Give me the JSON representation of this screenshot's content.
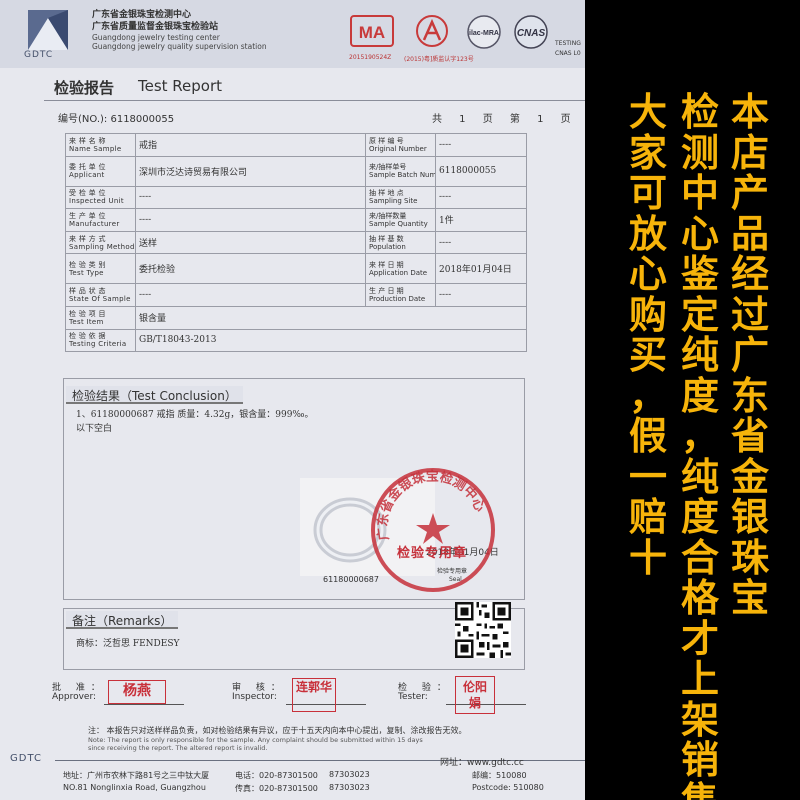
{
  "lab": {
    "name_cn_1": "广东省金银珠宝检测中心",
    "name_cn_2": "广东省质量监督金银珠宝检验站",
    "name_en_1": "Guangdong jewelry testing center",
    "name_en_2": "Guangdong jewelry quality supervision station",
    "logo_text": "GDTC"
  },
  "certs": {
    "ma": "MA",
    "ma_no": "2015190524Z",
    "ca_no": "(2015)粤]质监认字123号",
    "ilac": "ilac-MRA",
    "cnas": "CNAS",
    "testing": "TESTING",
    "cnas_no": "CNAS L0"
  },
  "report": {
    "title_cn": "检验报告",
    "title_en": "Test Report",
    "number": "编号(NO.): 6118000055",
    "page_info": "共 1 页 第 1 页"
  },
  "fields": [
    {
      "label_cn": "来 样 名 称",
      "label_en": "Name Sample",
      "value": "戒指",
      "label2_cn": "原 样 编 号",
      "label2_en": "Original Number",
      "value2": "----"
    },
    {
      "label_cn": "委 托 单 位",
      "label_en": "Applicant",
      "value": "深圳市泛达诗贸易有限公司",
      "label2_cn": "来/抽样单号",
      "label2_en": "Sample Batch Number",
      "value2": "6118000055"
    },
    {
      "label_cn": "受 检 单 位",
      "label_en": "Inspected Unit",
      "value": "----",
      "label2_cn": "抽 样 地 点",
      "label2_en": "Sampling Site",
      "value2": "----"
    },
    {
      "label_cn": "生 产 单 位",
      "label_en": "Manufacturer",
      "value": "----",
      "label2_cn": "来/抽样数量",
      "label2_en": "Sample Quantity",
      "value2": "1件"
    },
    {
      "label_cn": "来 样 方 式",
      "label_en": "Sampling Method",
      "value": "送样",
      "label2_cn": "抽 样 基 数",
      "label2_en": "Population",
      "value2": "----"
    },
    {
      "label_cn": "检 验 类 别",
      "label_en": "Test Type",
      "value": "委托检验",
      "label2_cn": "来 样 日 期",
      "label2_en": "Application Date",
      "value2": "2018年01月04日"
    },
    {
      "label_cn": "样 品 状 态",
      "label_en": "State Of Sample",
      "value": "----",
      "label2_cn": "生 产 日 期",
      "label2_en": "Production Date",
      "value2": "----"
    },
    {
      "label_cn": "检 验 项 目",
      "label_en": "Test Item",
      "value": "银含量"
    },
    {
      "label_cn": "检 验 依 据",
      "label_en": "Testing Criteria",
      "value": "GB/T18043-2013"
    }
  ],
  "conclusion": {
    "heading": "检验结果（Test Conclusion）",
    "line1": "1、61180000687    戒指   质量：4.32g，银含量：999‰。",
    "line2": "以下空白",
    "photo_no": "61180000687",
    "seal_date": "2018年01月04日",
    "seal_label": "检验专用章",
    "seal_label_en": "Seal",
    "seal_ring_text": "广东省金银珠宝检测中心",
    "seal_text_bottom": "检验专用章"
  },
  "remarks": {
    "heading": "备注（Remarks）",
    "text": "商标：泛哲思 FENDESY"
  },
  "signatures": {
    "approver_cn": "批 准：",
    "approver_en": "Approver:",
    "approver_stamp": "杨燕",
    "inspector_cn": "审 核：",
    "inspector_en": "Inspector:",
    "inspector_stamp": "连郭华",
    "tester_cn": "检 验：",
    "tester_en": "Tester:",
    "tester_stamp": "伦阳娟"
  },
  "footer": {
    "note_cn": "注：  本报告只对送样样品负责，如对检验结果有异议，应于十五天内向本中心提出，复制、涂改报告无效。",
    "note_en_1": "Note:  The report is only responsible for the sample. Any complaint should be submitted within 15 days",
    "note_en_2": "since receiving the report. The altered report is invalid.",
    "gdtc": "GDTC",
    "website": "网址：www.gdtc.cc",
    "address_cn": "地址：广州市农林下路81号之三中钛大厦",
    "address_en": "NO.81 Nonglinxia Road, Guangzhou",
    "phone_label": "电话：020-87301500",
    "phone_2": "87303023",
    "fax_label": "传真：020-87301500",
    "fax_2": "87303023",
    "postcode_label": "邮编：510080",
    "postcode_label_en": "Postcode: 510080"
  },
  "promo": {
    "col1": "本店产品经过广东省金银珠宝",
    "col2": "检测中心鉴定纯度，纯度合格才上架销售",
    "col3": "大家可放心购买，假一赔十"
  },
  "colors": {
    "promo_text": "#f7b40a",
    "seal_red": "#c5303a",
    "background": "#000000",
    "paper": "#e7e8ee"
  }
}
